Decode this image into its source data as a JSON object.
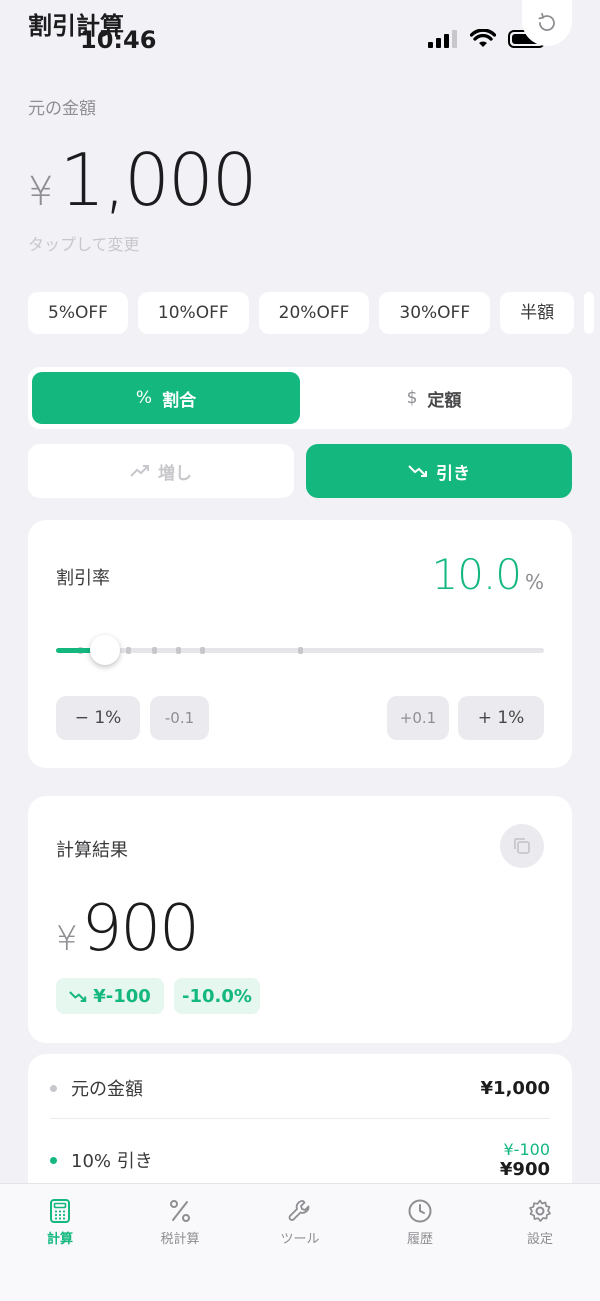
{
  "status": {
    "time": "10:46"
  },
  "header": {
    "title": "割引計算"
  },
  "input": {
    "label": "元の金額",
    "currency_symbol": "¥",
    "amount": "1,000",
    "hint": "タップして変更"
  },
  "presets": [
    "5%OFF",
    "10%OFF",
    "20%OFF",
    "30%OFF",
    "半額"
  ],
  "mode_toggle": {
    "percent_icon": "%",
    "percent_label": "割合",
    "fixed_icon": "$",
    "fixed_label": "定額",
    "active": "percent"
  },
  "direction_toggle": {
    "increase_label": "増し",
    "decrease_label": "引き",
    "active": "decrease"
  },
  "rate": {
    "label": "割引率",
    "value": "10.0",
    "unit": "%",
    "slider_fraction": 0.1,
    "buttons": {
      "minus_one": "− 1%",
      "minus_tenth": "-0.1",
      "plus_tenth": "+0.1",
      "plus_one": "+ 1%"
    }
  },
  "result": {
    "label": "計算結果",
    "currency_symbol": "¥",
    "value": "900",
    "diff_amount": "¥-100",
    "diff_percent": "-10.0%"
  },
  "breakdown": [
    {
      "label": "元の金額",
      "value": "¥1,000"
    },
    {
      "label": "10% 引き",
      "sub_value": "¥-100",
      "value": "¥900"
    }
  ],
  "tabs": [
    {
      "label": "計算",
      "icon": "calculator-icon"
    },
    {
      "label": "税計算",
      "icon": "percent-icon"
    },
    {
      "label": "ツール",
      "icon": "wrench-icon"
    },
    {
      "label": "履歴",
      "icon": "clock-icon"
    },
    {
      "label": "設定",
      "icon": "gear-icon"
    }
  ],
  "colors": {
    "accent": "#14b87f",
    "background": "#f2f2f6",
    "card": "#ffffff"
  }
}
